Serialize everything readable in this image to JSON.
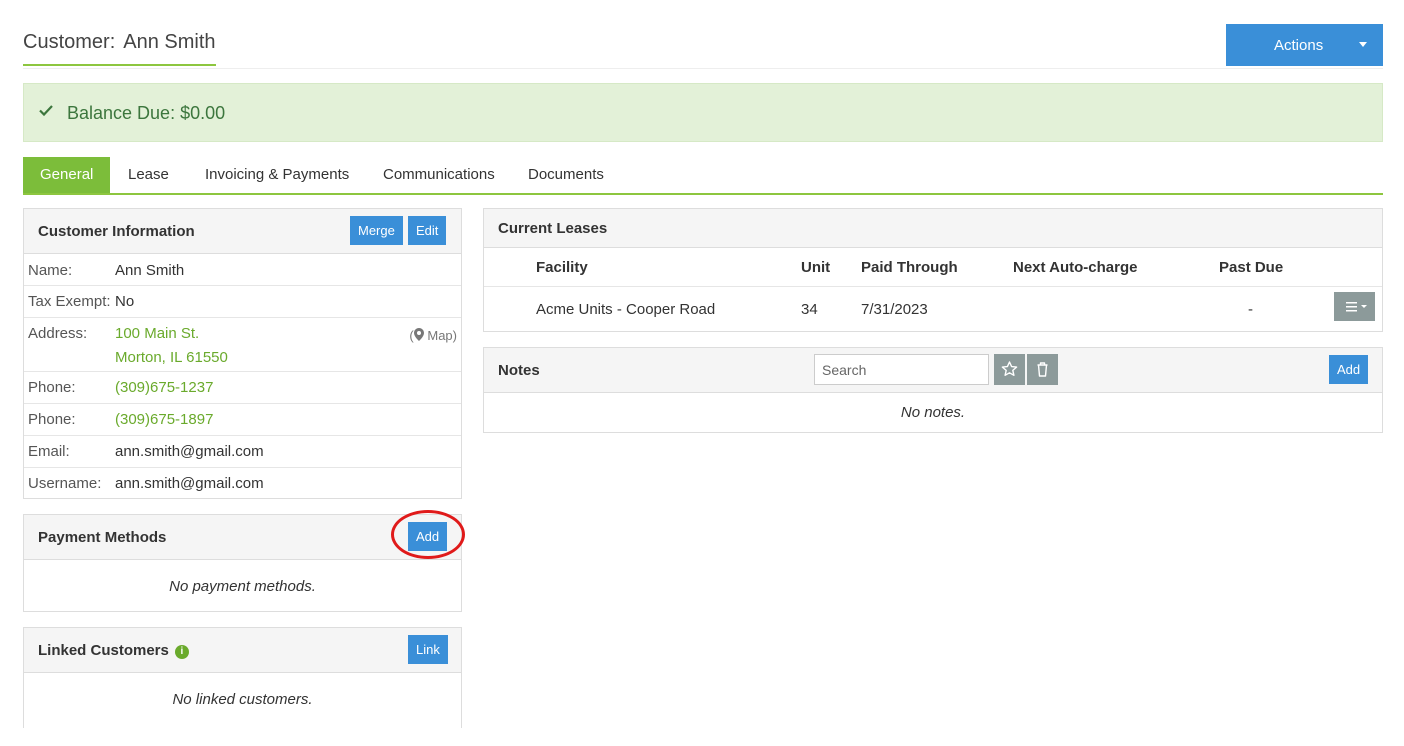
{
  "header": {
    "title_label": "Customer:",
    "title_name": "Ann Smith",
    "actions_label": "Actions"
  },
  "alert": {
    "label": "Balance Due:",
    "value": "$0.00"
  },
  "tabs": [
    {
      "label": "General",
      "active": true
    },
    {
      "label": "Lease",
      "active": false
    },
    {
      "label": "Invoicing & Payments",
      "active": false
    },
    {
      "label": "Communications",
      "active": false
    },
    {
      "label": "Documents",
      "active": false
    }
  ],
  "customer_info": {
    "title": "Customer Information",
    "merge_label": "Merge",
    "edit_label": "Edit",
    "name_label": "Name:",
    "name": "Ann Smith",
    "tax_label": "Tax Exempt:",
    "tax": "No",
    "address_label": "Address:",
    "address_line1": "100 Main St.",
    "address_line2": "Morton, IL 61550",
    "map_label": "Map",
    "phone_label": "Phone:",
    "phone1": "(309)675-1237",
    "phone2": "(309)675-1897",
    "email_label": "Email:",
    "email": "ann.smith@gmail.com",
    "username_label": "Username:",
    "username": "ann.smith@gmail.com"
  },
  "payment_methods": {
    "title": "Payment Methods",
    "add_label": "Add",
    "empty": "No payment methods."
  },
  "linked_customers": {
    "title": "Linked Customers",
    "link_label": "Link",
    "empty": "No linked customers."
  },
  "current_leases": {
    "title": "Current Leases",
    "columns": {
      "facility": "Facility",
      "unit": "Unit",
      "paid_through": "Paid Through",
      "next_autocharge": "Next Auto-charge",
      "past_due": "Past Due"
    },
    "rows": [
      {
        "facility": "Acme Units - Cooper Road",
        "unit": "34",
        "paid_through": "7/31/2023",
        "next_autocharge": "",
        "past_due": "-"
      }
    ]
  },
  "notes": {
    "title": "Notes",
    "search_placeholder": "Search",
    "add_label": "Add",
    "empty": "No notes."
  },
  "colors": {
    "primary": "#3a8fd8",
    "success_green": "#7cbd3a",
    "link_green": "#6aaa2c",
    "alert_bg": "#e3f1d8",
    "annotation_red": "#e01a1a"
  }
}
